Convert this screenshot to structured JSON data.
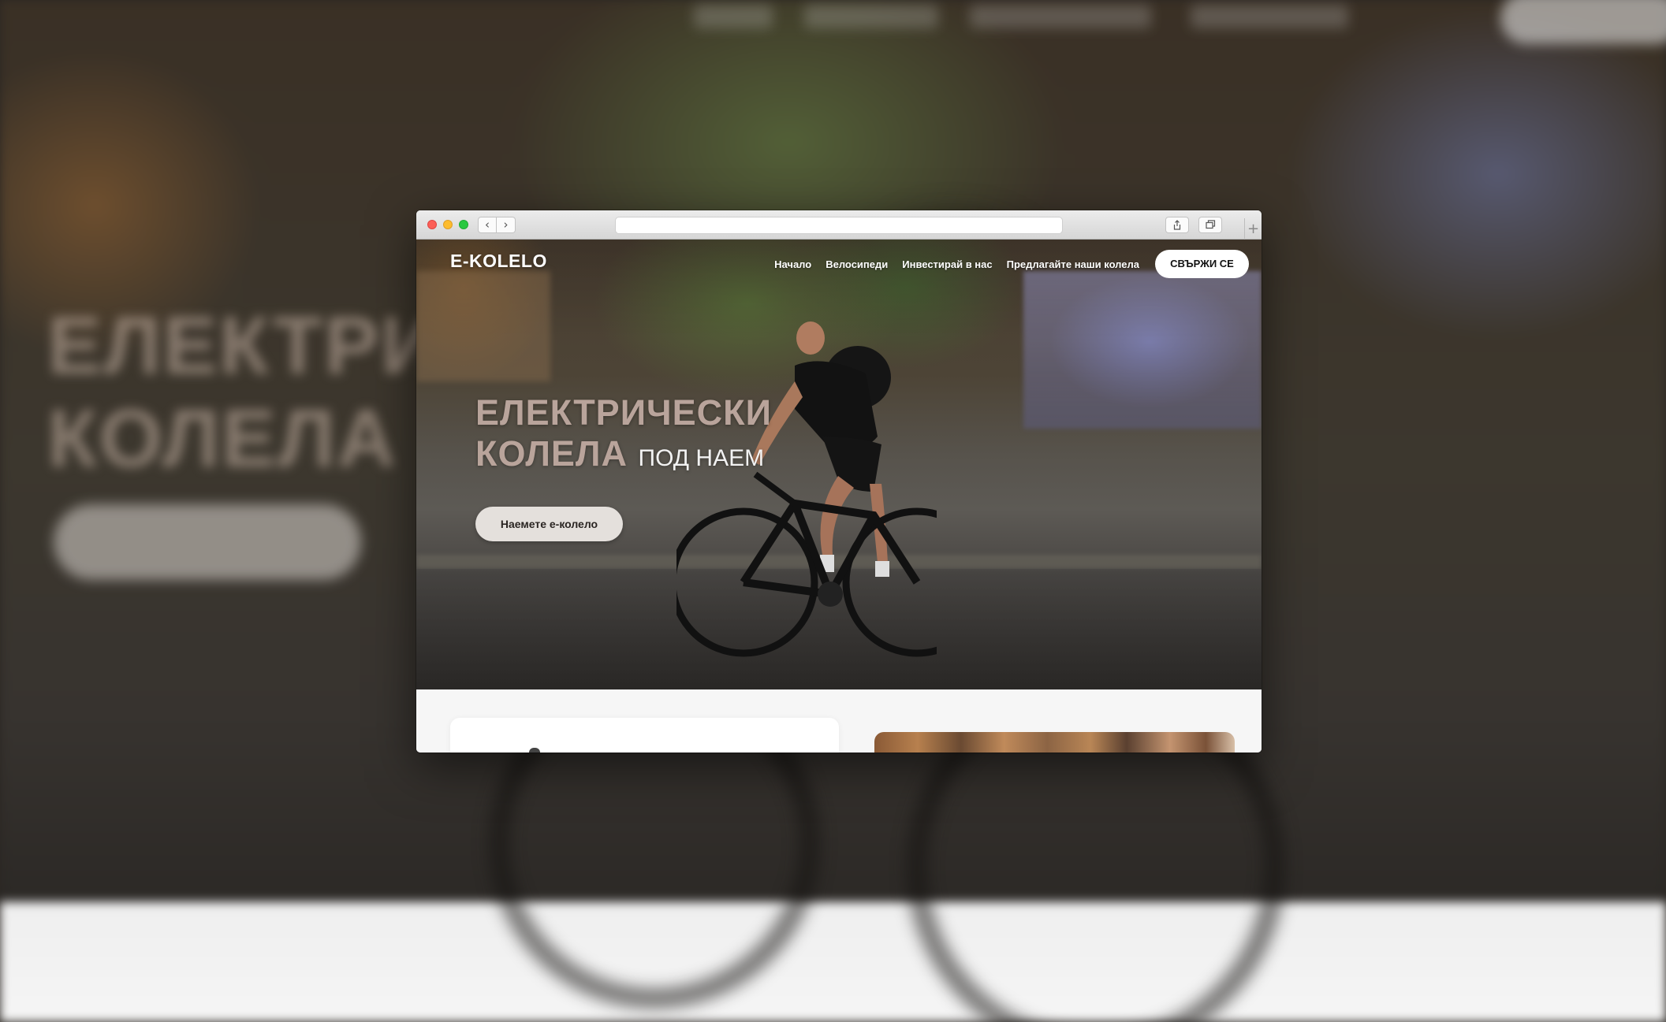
{
  "site": {
    "logo": "E-KOLELO",
    "nav": [
      "Начало",
      "Велосипеди",
      "Инвестирай в нас",
      "Предлагайте наши колела"
    ],
    "contact_button": "СВЪРЖИ СЕ"
  },
  "hero": {
    "title_line1": "ЕЛЕКТРИЧЕСКИ",
    "title_line2": "КОЛЕЛА",
    "title_suffix": "ПОД НАЕМ",
    "cta_button": "Наемете е-колело"
  },
  "backdrop": {
    "title_line1": "ЕЛЕКТРИ",
    "title_line2": "КОЛЕЛА"
  },
  "browser": {
    "url": "",
    "icons": [
      "back-icon",
      "forward-icon",
      "share-icon",
      "tabs-icon",
      "new-tab-icon"
    ]
  },
  "colors": {
    "hero_title": "#b9a49b",
    "cta_bg": "#e4e0dc",
    "contact_bg": "#ffffff",
    "traffic_red": "#fc5f57",
    "traffic_yellow": "#fdbc2e",
    "traffic_green": "#28c840"
  }
}
